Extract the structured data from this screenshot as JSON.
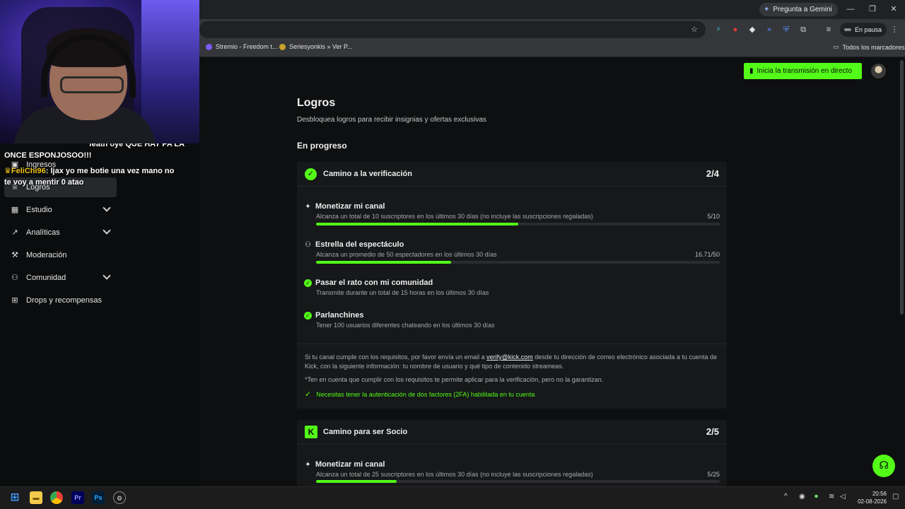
{
  "browser": {
    "gemini_label": "Pregunta a Gemini",
    "pause_label": "En pausa",
    "bookmarks": [
      {
        "label": "Stremio - Freedom t..."
      },
      {
        "label": "Seriesyonkis » Ver P..."
      }
    ],
    "all_bookmarks_label": "Todos los marcadores"
  },
  "chat": {
    "line1_user": "",
    "line1_text": "feath oye QUE HAY PA LA",
    "line1_cont": "ONCE ESPONJOSOO!!!",
    "line2_user": "FeliChi96",
    "line2_text": ": ljax yo me botie una vez mano no",
    "line2_cont": "te voy a mentir 0 atao"
  },
  "sidebar": {
    "items": [
      {
        "label": "Ingresos",
        "icon": "revenue-icon"
      },
      {
        "label": "Logros",
        "icon": "trophy-icon"
      },
      {
        "label": "Estudio",
        "icon": "studio-icon"
      },
      {
        "label": "Analíticas",
        "icon": "analytics-icon"
      },
      {
        "label": "Moderación",
        "icon": "wrench-icon"
      },
      {
        "label": "Comunidad",
        "icon": "community-icon"
      },
      {
        "label": "Drops y recompensas",
        "icon": "drops-icon"
      }
    ]
  },
  "header": {
    "go_live_label": "Inicia la transmisión en directo"
  },
  "page": {
    "title": "Logros",
    "subtitle": "Desbloquea logros para recibir insignias y ofertas exclusivas",
    "section": "En progreso"
  },
  "cards": [
    {
      "title": "Camino a la verificación",
      "count": "2/4",
      "tasks": [
        {
          "title": "Monetizar mi canal",
          "desc": "Alcanza un total de 10 suscriptores en los últimos 30 días (no incluye las suscripciones regaladas)",
          "value": "5/10",
          "progress": 0.5,
          "done": false
        },
        {
          "title": "Estrella del espectáculo",
          "desc": "Alcanza un promedio de 50 espectadores en los últimos 30 días",
          "value": "16.71/50",
          "progress": 0.334,
          "done": false
        },
        {
          "title": "Pasar el rato con mi comunidad",
          "desc": "Transmite durante un total de 15 horas en los últimos 30 días",
          "done": true
        },
        {
          "title": "Parlanchines",
          "desc": "Tener 100 usuarios diferentes chateando en los últimos 30 días",
          "done": true
        }
      ],
      "info_pre": "Si tu canal cumple con los requisitos, por favor envía un email a ",
      "info_email": "verify@kick.com",
      "info_post": " desde tu dirección de correo electrónico asociada a tu cuenta de Kick, con la siguiente información: tu nombre de usuario y qué tipo de contenido streameas.",
      "note": "*Ten en cuenta que cumplir con los requisitos te permite aplicar para la verificación, pero no la garantizan.",
      "requirement": "Necesitas tener la autenticación de dos factores (2FA) habilitada en tu cuenta"
    },
    {
      "title": "Camino para ser Socio",
      "count": "2/5",
      "tasks": [
        {
          "title": "Monetizar mi canal",
          "desc": "Alcanza un total de 25 suscriptores en los últimos 30 días (no incluye las suscripciones regaladas)",
          "value": "5/25",
          "progress": 0.2,
          "done": false
        }
      ]
    }
  ],
  "taskbar": {
    "time": "20:56",
    "date": "02-08-2026"
  },
  "colors": {
    "accent": "#53fc18",
    "background": "#0e0f10",
    "card": "#16181a"
  }
}
